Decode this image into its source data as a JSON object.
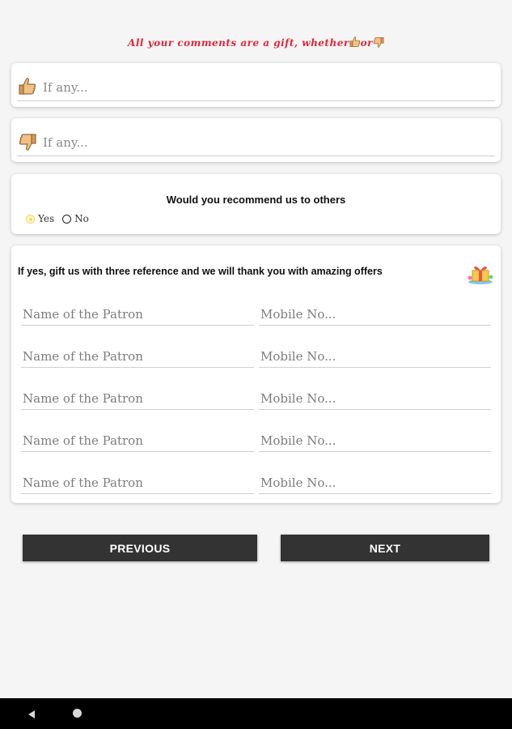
{
  "tagline": {
    "text": "All your comments are a gift, whether",
    "connector": "or",
    "icons": [
      "thumbs-up-icon",
      "thumbs-down-icon"
    ]
  },
  "comments": [
    {
      "icon": "thumbs-up-icon",
      "placeholder": "If any..."
    },
    {
      "icon": "thumbs-down-icon",
      "placeholder": "If any..."
    }
  ],
  "recommend": {
    "question": "Would you recommend us to others",
    "options": {
      "yes": "Yes",
      "no": "No"
    }
  },
  "references": {
    "title": "If yes, gift us with three reference and we will thank you with amazing offers",
    "icon": "gift-icon",
    "name_placeholder": "Name of the Patron",
    "mobile_placeholder": "Mobile No..."
  },
  "buttons": {
    "previous": "PREVIOUS",
    "next": "NEXT"
  },
  "colors": {
    "accent_red": "#e0263b",
    "button_bg": "#333333",
    "page_bg": "#f5f5f5"
  }
}
